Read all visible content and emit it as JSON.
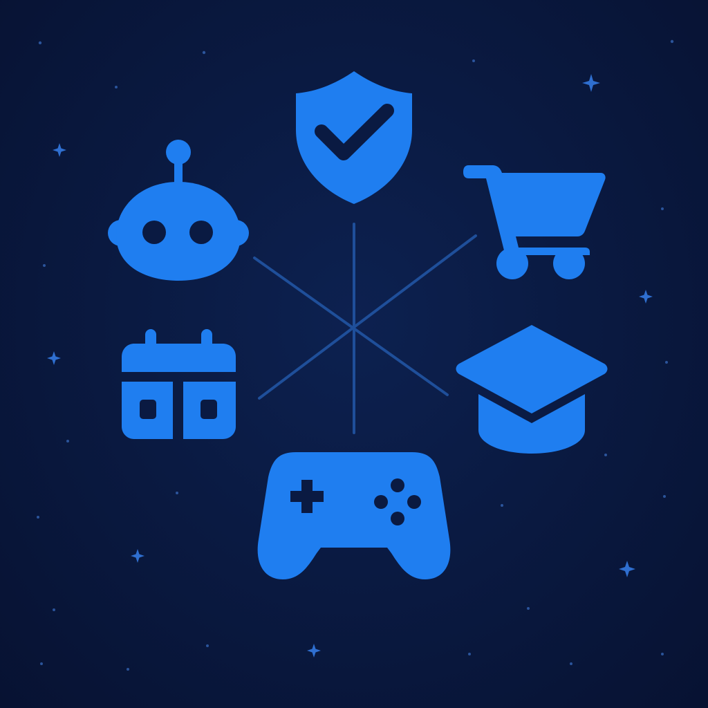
{
  "colors": {
    "background": "#0a1a42",
    "icon_fill": "#1f7ef0",
    "connector_line": "#1f4f9a",
    "sparkle": "#2f6fd0",
    "dot": "#3a6fc4"
  },
  "hub": {
    "spokes": 6
  },
  "icons": [
    {
      "name": "shield-check-icon",
      "meaning": "security"
    },
    {
      "name": "shopping-cart-icon",
      "meaning": "shopping"
    },
    {
      "name": "graduation-cap-icon",
      "meaning": "education"
    },
    {
      "name": "gamepad-icon",
      "meaning": "gaming"
    },
    {
      "name": "calendar-icon",
      "meaning": "scheduling"
    },
    {
      "name": "robot-icon",
      "meaning": "ai-assistant"
    }
  ]
}
